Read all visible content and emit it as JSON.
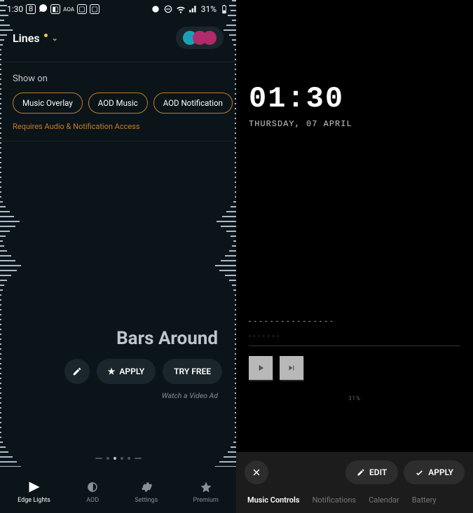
{
  "left": {
    "status": {
      "time": "1:30",
      "battery": "31%"
    },
    "dropdown": {
      "label": "Lines"
    },
    "show_on": {
      "label": "Show on",
      "chips": [
        "Music Overlay",
        "AOD Music",
        "AOD Notification"
      ],
      "note": "Requires Audio & Notification Access"
    },
    "visual": {
      "title": "Bars Around",
      "apply": "APPLY",
      "try_free": "TRY FREE",
      "subnote": "Watch a Video Ad"
    },
    "nav": {
      "items": [
        {
          "label": "Edge Lights"
        },
        {
          "label": "AOD"
        },
        {
          "label": "Settings"
        },
        {
          "label": "Premium"
        }
      ]
    }
  },
  "right": {
    "clock": "01:30",
    "date": "THURSDAY, 07 APRIL",
    "battery": "31%",
    "bar": {
      "edit": "EDIT",
      "apply": "APPLY",
      "tabs": [
        "Music Controls",
        "Notifications",
        "Calendar",
        "Battery"
      ]
    }
  }
}
